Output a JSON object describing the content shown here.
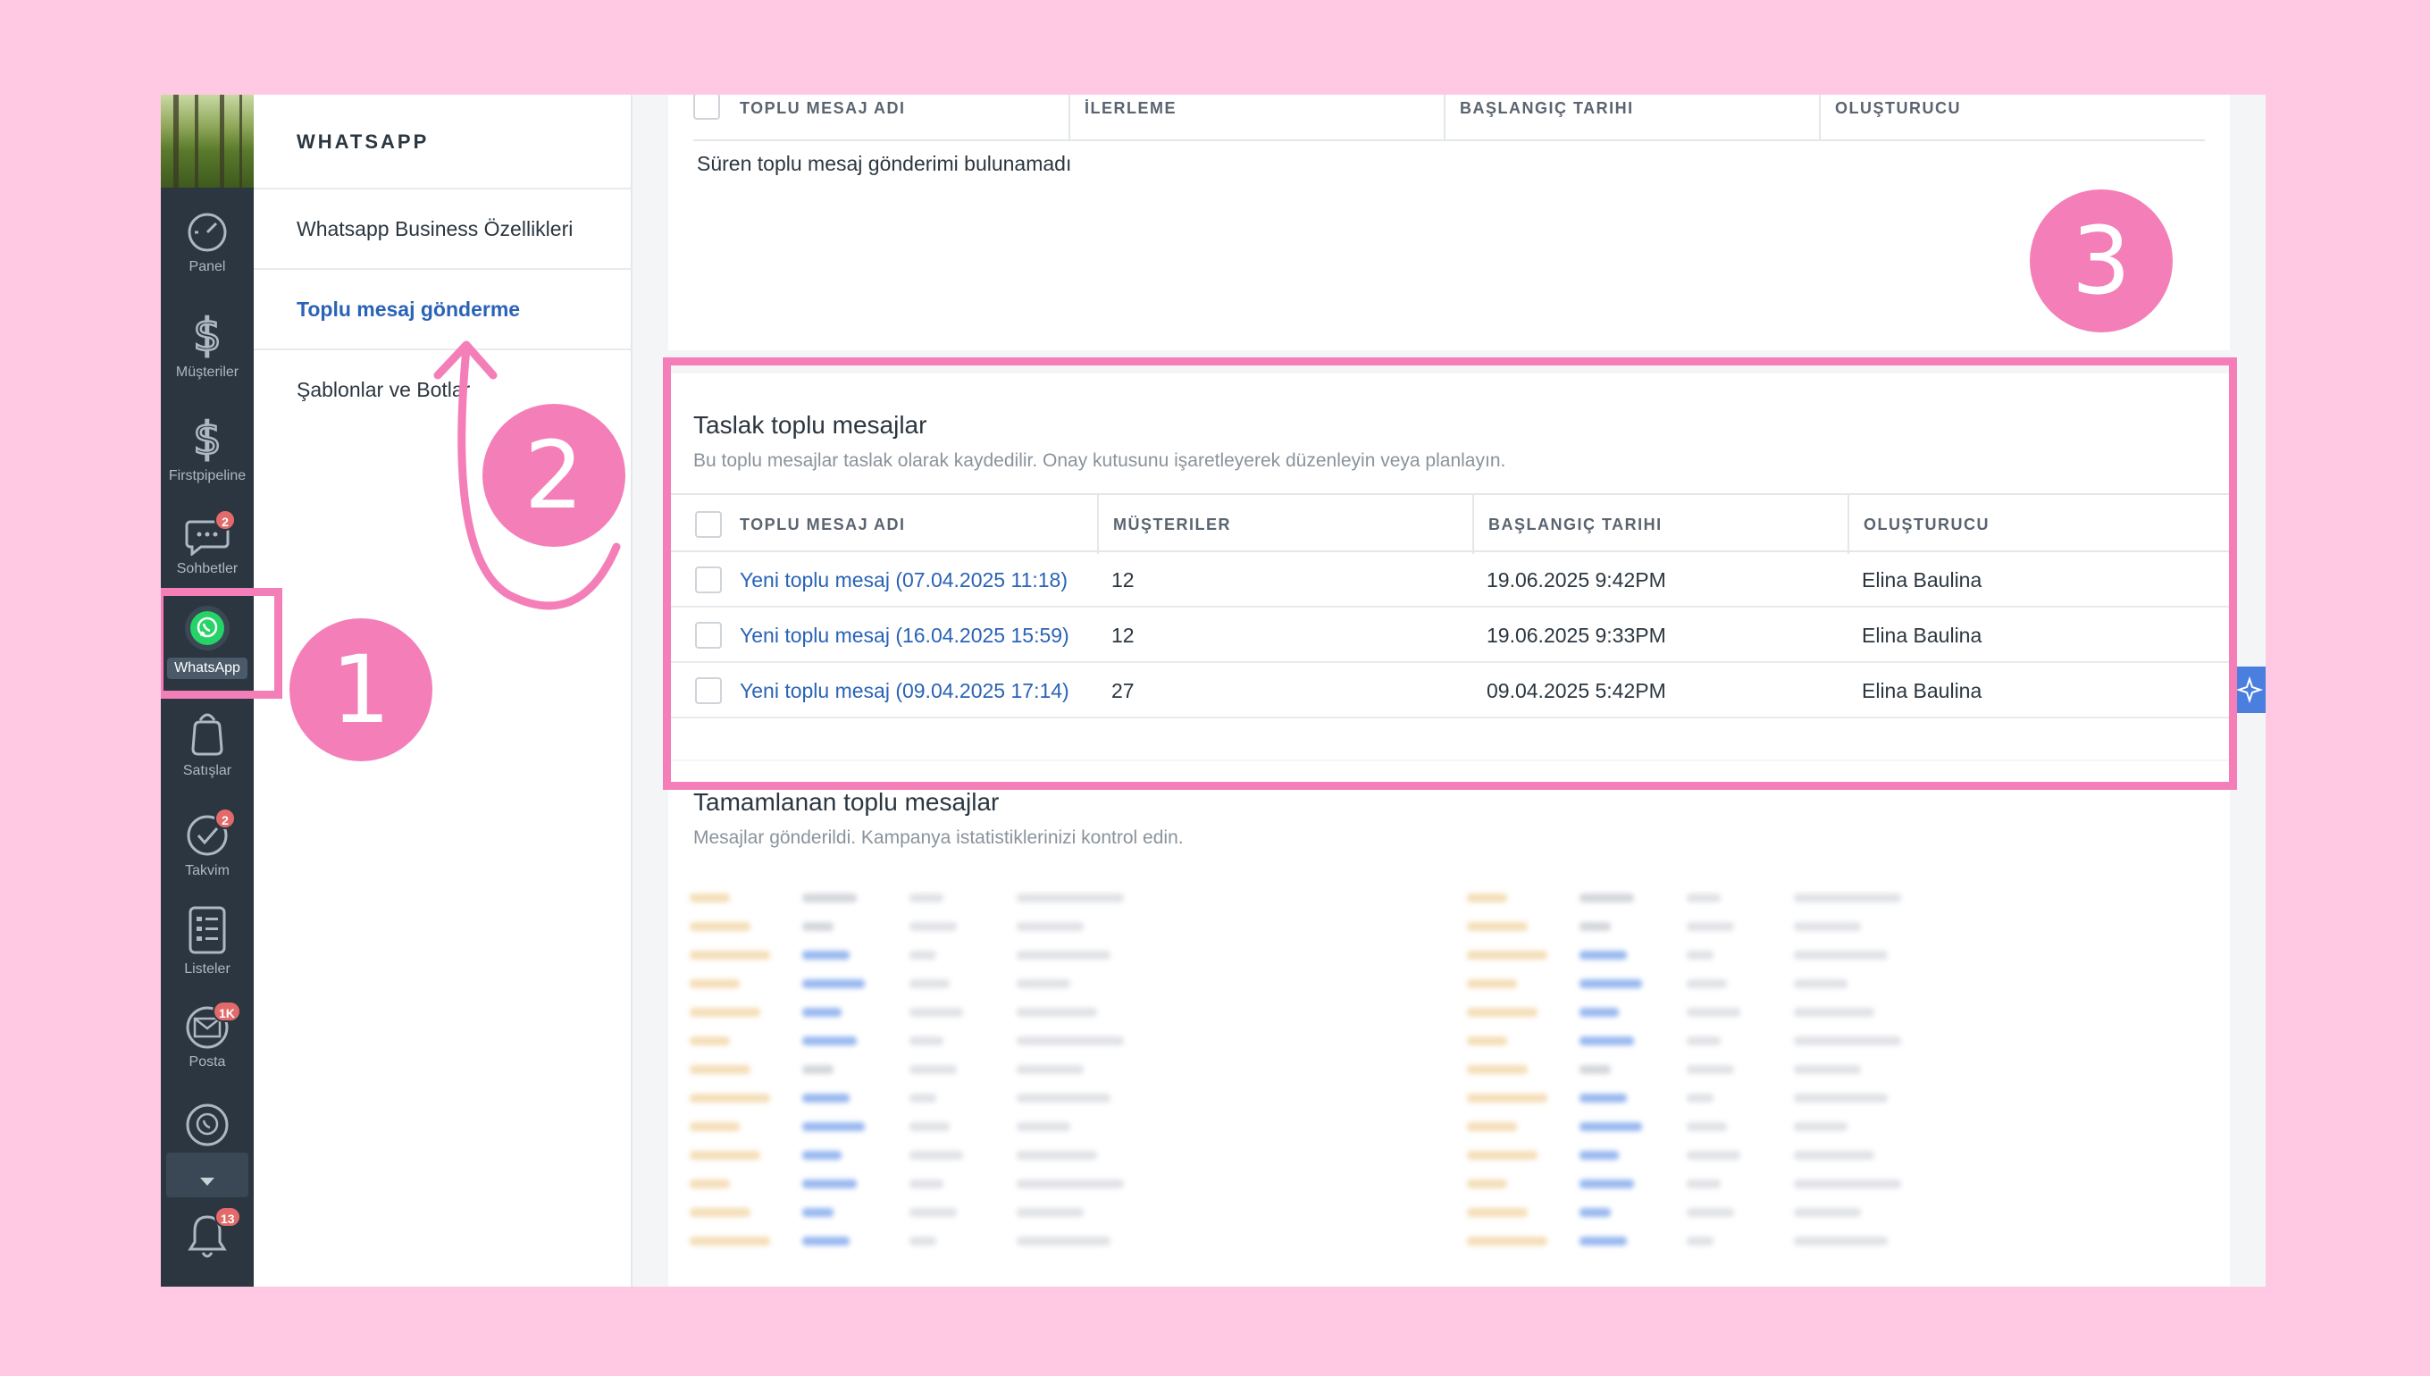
{
  "sidebar": {
    "items": [
      {
        "label": "Panel",
        "icon": "gauge-icon"
      },
      {
        "label": "Müşteriler",
        "icon": "dollar-icon"
      },
      {
        "label": "Firstpipeline",
        "icon": "dollar-icon"
      },
      {
        "label": "Sohbetler",
        "icon": "chat-bubble-icon",
        "badge": "2"
      },
      {
        "label": "WhatsApp",
        "icon": "whatsapp-icon",
        "active": true
      },
      {
        "label": "Satışlar",
        "icon": "handbag-icon"
      },
      {
        "label": "Takvim",
        "icon": "check-circle-icon",
        "badge": "2"
      },
      {
        "label": "Listeler",
        "icon": "list-icon"
      },
      {
        "label": "Posta",
        "icon": "envelope-icon",
        "badge": "1K"
      },
      {
        "label": "",
        "icon": "whatsapp-icon"
      },
      {
        "label": "",
        "icon": "bell-icon",
        "badge": "13"
      }
    ]
  },
  "submenu": {
    "title": "WHATSAPP",
    "items": [
      {
        "label": "Whatsapp Business Özellikleri"
      },
      {
        "label": "Toplu mesaj gönderme",
        "active": true
      },
      {
        "label": "Şablonlar ve Botlar"
      }
    ]
  },
  "ongoing": {
    "columns": [
      "TOPLU MESAJ ADI",
      "İLERLEME",
      "BAŞLANGIÇ TARIHI",
      "OLUŞTURUCU"
    ],
    "empty_text": "Süren toplu mesaj gönderimi bulunamadı"
  },
  "drafts": {
    "title": "Taslak toplu mesajlar",
    "subtitle": "Bu toplu mesajlar taslak olarak kaydedilir. Onay kutusunu işaretleyerek düzenleyin veya planlayın.",
    "columns": [
      "TOPLU MESAJ ADI",
      "MÜŞTERILER",
      "BAŞLANGIÇ TARIHI",
      "OLUŞTURUCU"
    ],
    "rows": [
      {
        "name": "Yeni toplu mesaj (07.04.2025 11:18)",
        "customers": "12",
        "start": "19.06.2025 9:42PM",
        "creator": "Elina Baulina"
      },
      {
        "name": "Yeni toplu mesaj (16.04.2025 15:59)",
        "customers": "12",
        "start": "19.06.2025 9:33PM",
        "creator": "Elina Baulina"
      },
      {
        "name": "Yeni toplu mesaj (09.04.2025 17:14)",
        "customers": "27",
        "start": "09.04.2025 5:42PM",
        "creator": "Elina Baulina"
      }
    ]
  },
  "completed": {
    "title": "Tamamlanan toplu mesajlar",
    "subtitle": "Mesajlar gönderildi. Kampanya istatistiklerinizi kontrol edin."
  },
  "annotations": {
    "step1": "1",
    "step2": "2",
    "step3": "3"
  },
  "colors": {
    "accent": "#f47fb8",
    "link": "#2a63b6",
    "rail": "#2b3640",
    "background": "#ffc9e3",
    "whatsapp": "#25d366"
  }
}
